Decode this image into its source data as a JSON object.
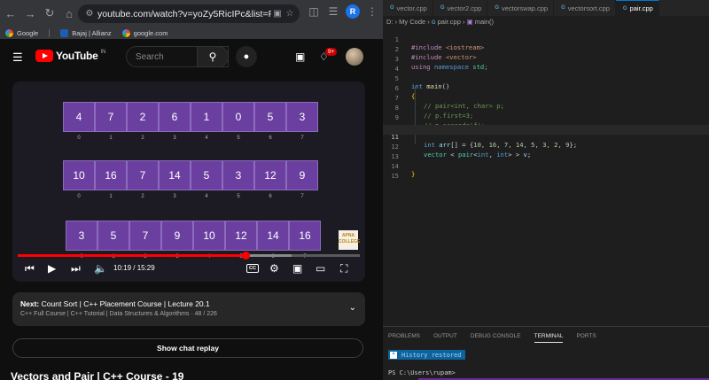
{
  "browser": {
    "url": "youtube.com/watch?v=yoZy5RicIPc&list=PLfqMhTW...",
    "bookmarks": [
      "Google",
      "Bajaj | Allianz",
      "google.com"
    ],
    "profile_initial": "R"
  },
  "youtube": {
    "logo_text": "YouTube",
    "country": "IN",
    "search_placeholder": "Search",
    "notifications_badge": "9+",
    "player": {
      "array1": {
        "values": [
          "4",
          "7",
          "2",
          "6",
          "1",
          "0",
          "5",
          "3"
        ],
        "indices": [
          "0",
          "1",
          "2",
          "3",
          "4",
          "5",
          "6",
          "7"
        ]
      },
      "array2": {
        "values": [
          "10",
          "16",
          "7",
          "14",
          "5",
          "3",
          "12",
          "9"
        ],
        "indices": [
          "0",
          "1",
          "2",
          "3",
          "4",
          "5",
          "6",
          "7"
        ]
      },
      "array3": {
        "values": [
          "3",
          "5",
          "7",
          "9",
          "10",
          "12",
          "14",
          "16"
        ],
        "indices": [
          "0",
          "1",
          "2",
          "3",
          "4",
          "5",
          "6",
          "7"
        ]
      },
      "watermark": [
        "APNA",
        "COLLEGE"
      ],
      "time_current": "10:19",
      "time_total": "15:29",
      "time_display": "10:19 / 15:29",
      "progress_fraction": 0.665,
      "buffer_fraction": 0.8,
      "cc_label": "CC"
    },
    "next": {
      "prefix": "Next:",
      "title": "Count Sort | C++ Placement Course | Lecture 20.1",
      "subtitle": "C++ Full Course | C++ Tutorial | Data Structures & Algorithms · 48 / 226"
    },
    "chat_button": "Show chat replay",
    "video_title": "Vectors and Pair | C++ Course - 19"
  },
  "vscode": {
    "tabs": [
      {
        "label": "vector.cpp",
        "active": false
      },
      {
        "label": "vector2.cpp",
        "active": false
      },
      {
        "label": "vectorswap.cpp",
        "active": false
      },
      {
        "label": "vectorsort.cpp",
        "active": false
      },
      {
        "label": "pair.cpp",
        "active": true
      }
    ],
    "breadcrumb": {
      "drive": "D:",
      "folder": "My Code",
      "file": "pair.cpp",
      "symbol": "main()"
    },
    "current_line": 11,
    "line_numbers": [
      "1",
      "2",
      "3",
      "4",
      "5",
      "6",
      "7",
      "8",
      "9",
      "10",
      "11",
      "12",
      "13",
      "14",
      "15"
    ],
    "code": {
      "l1a": "#include",
      "l1b": " <iostream>",
      "l2a": "#include",
      "l2b": " <vector>",
      "l3a": "using",
      "l3b": " namespace",
      "l3c": " std;",
      "l5a": "int",
      "l5b": " main",
      "l5c": "()",
      "l6": "{",
      "l7": "// pair<int, char> p;",
      "l8": "// p.first=3;",
      "l9": "// p.second='f';",
      "l11a": "int",
      "l11b": " arr",
      "l11c": "[] = {",
      "l11d": "10, 16, 7, 14, 5, 3, 2, 9",
      "l11e": "};",
      "l12a": "vector",
      "l12b": " < ",
      "l12c": "pair",
      "l12d": "<",
      "l12e": "int",
      "l12f": ", ",
      "l12g": "int",
      "l12h": "> > ",
      "l12i": "v",
      "l12j": ";",
      "l14": "}"
    },
    "panel": {
      "tabs": [
        "PROBLEMS",
        "OUTPUT",
        "DEBUG CONSOLE",
        "TERMINAL",
        "PORTS"
      ],
      "active_tab": "TERMINAL",
      "history_text": "History restored",
      "prompt": "PS C:\\Users\\rupam>"
    }
  }
}
